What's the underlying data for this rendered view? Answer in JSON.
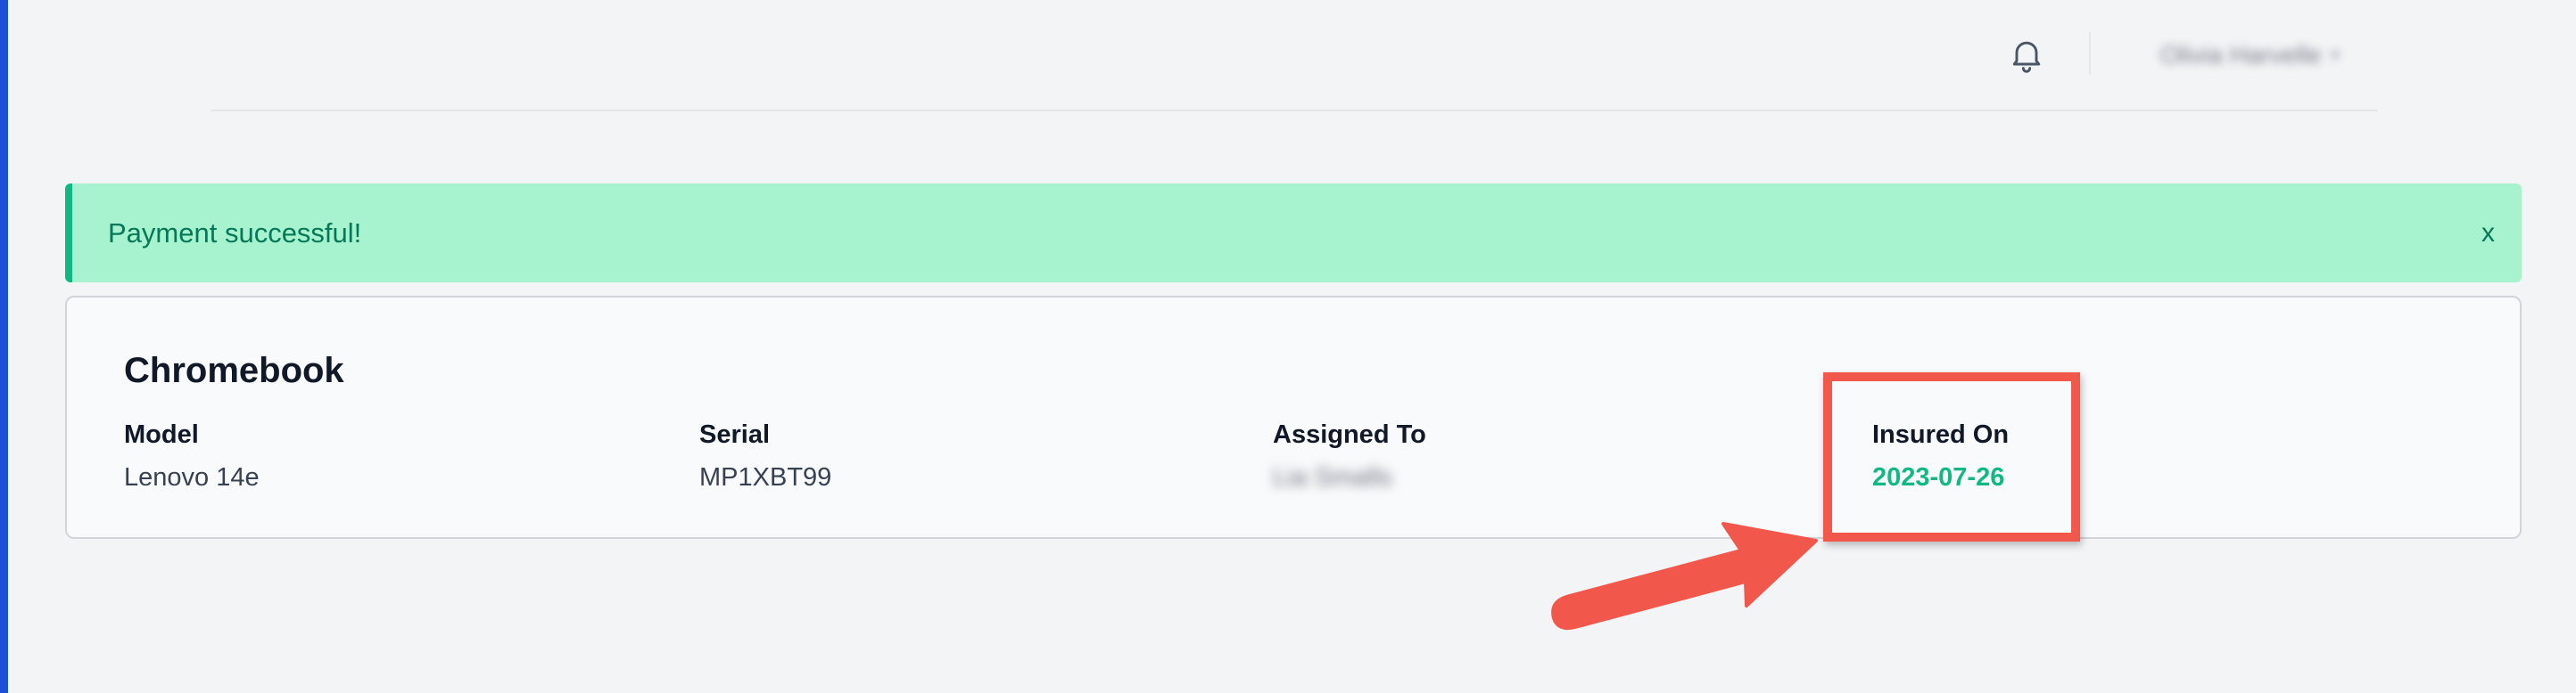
{
  "header": {
    "notifications_icon": "bell-icon",
    "user_name": "Olivia Harvelle",
    "user_menu_icon": "chevron-down-icon"
  },
  "alert": {
    "message": "Payment successful!",
    "close_label": "x"
  },
  "device": {
    "title": "Chromebook",
    "fields": [
      {
        "label": "Model",
        "value": "Lenovo 14e"
      },
      {
        "label": "Serial",
        "value": "MP1XBT99"
      },
      {
        "label": "Assigned To",
        "value": "Lia Smalls"
      },
      {
        "label": "Insured On",
        "value": "2023-07-26"
      }
    ]
  },
  "colors": {
    "accent_green": "#10b981",
    "alert_bg": "#a7f3d0",
    "annotation_red": "#f2574c",
    "sidebar_blue": "#1d4ed8"
  }
}
